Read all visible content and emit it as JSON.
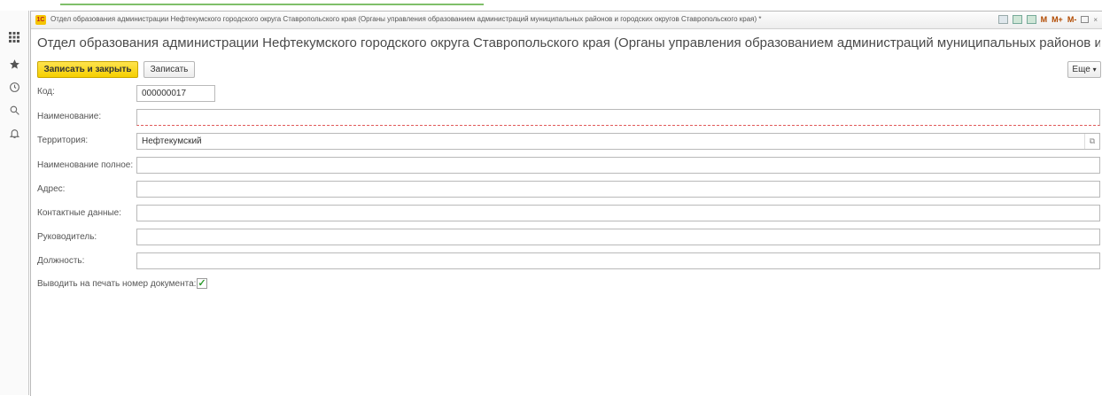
{
  "window": {
    "title": "Отдел образования администрации Нефтекумского городского округа Ставропольского края (Органы управления образованием администраций муниципальных районов и городских округов Ставропольского края) *",
    "logo_text": "1С",
    "toolbar_icons": [
      "print-icon",
      "calendar-icon",
      "calculator-icon",
      "memory-m-icon",
      "memory-plus-icon",
      "memory-minus-icon",
      "window-icon",
      "close-icon"
    ],
    "memory_labels": {
      "m": "M",
      "mplus": "M+",
      "mminus": "M-"
    }
  },
  "heading": "Отдел образования администрации Нефтекумского городского округа Ставропольского края (Органы управления образованием администраций муниципальных районов и городских округов Ставроп",
  "commands": {
    "save_close": "Записать и закрыть",
    "save": "Записать",
    "more": "Еще",
    "more_chevron": "▾"
  },
  "sidebar": {
    "icons": [
      "apps-grid-icon",
      "star-icon",
      "history-icon",
      "search-icon",
      "bell-icon"
    ]
  },
  "form": {
    "code": {
      "label": "Код:",
      "value": "000000017"
    },
    "name": {
      "label": "Наименование:",
      "value": ""
    },
    "territory": {
      "label": "Территория:",
      "value": "Нефтекумский"
    },
    "full_name": {
      "label": "Наименование полное:",
      "value": ""
    },
    "address": {
      "label": "Адрес:",
      "value": ""
    },
    "contacts": {
      "label": "Контактные данные:",
      "value": ""
    },
    "head": {
      "label": "Руководитель:",
      "value": ""
    },
    "position": {
      "label": "Должность:",
      "value": ""
    },
    "print_number": {
      "label": "Выводить на печать номер документа:",
      "checked": true
    }
  },
  "colors": {
    "accent": "#f5cf00",
    "required": "#e05a5a",
    "check": "#2e9b2e"
  }
}
